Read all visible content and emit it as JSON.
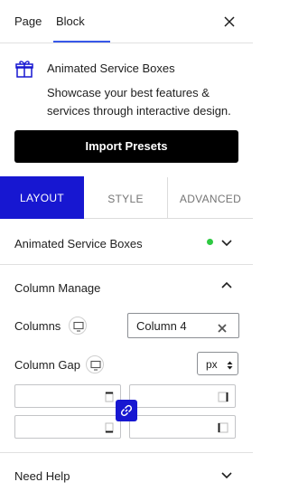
{
  "header": {
    "tabs": [
      {
        "label": "Page"
      },
      {
        "label": "Block"
      }
    ],
    "active_tab": "Block"
  },
  "block": {
    "title": "Animated Service Boxes",
    "description": "Showcase your best features & services through interactive design.",
    "import_button": "Import Presets"
  },
  "panel_tabs": [
    {
      "label": "LAYOUT"
    },
    {
      "label": "STYLE"
    },
    {
      "label": "ADVANCED"
    }
  ],
  "active_panel_tab": "LAYOUT",
  "sections": {
    "animated": {
      "title": "Animated Service Boxes",
      "status_dot_color": "#2ec942"
    },
    "column_manage": {
      "title": "Column Manage"
    },
    "need_help": {
      "title": "Need Help"
    }
  },
  "column_manage": {
    "columns_label": "Columns",
    "columns_value": "Column 4",
    "gap_label": "Column Gap",
    "gap_unit": "px",
    "gap_top": "",
    "gap_right": "",
    "gap_bottom": "",
    "gap_left": ""
  },
  "colors": {
    "accent": "#1717d1",
    "tab_underline": "#3858e9",
    "button_bg": "#000000",
    "status_green": "#2ec942"
  }
}
